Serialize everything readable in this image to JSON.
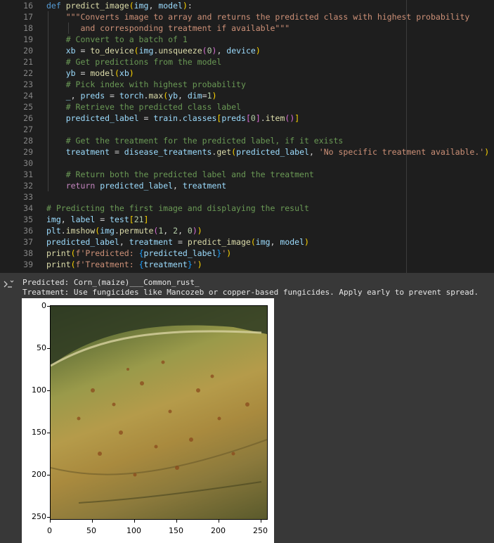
{
  "code": {
    "lines": [
      {
        "n": "16"
      },
      {
        "n": "17"
      },
      {
        "n": "18"
      },
      {
        "n": "19"
      },
      {
        "n": "20"
      },
      {
        "n": "21"
      },
      {
        "n": "22"
      },
      {
        "n": "23"
      },
      {
        "n": "24"
      },
      {
        "n": "25"
      },
      {
        "n": "26"
      },
      {
        "n": "27"
      },
      {
        "n": "28"
      },
      {
        "n": "29"
      },
      {
        "n": "30"
      },
      {
        "n": "31"
      },
      {
        "n": "32"
      },
      {
        "n": "33"
      },
      {
        "n": "34"
      },
      {
        "n": "35"
      },
      {
        "n": "36"
      },
      {
        "n": "37"
      },
      {
        "n": "38"
      },
      {
        "n": "39"
      }
    ]
  },
  "output": {
    "line1": "Predicted: Corn_(maize)___Common_rust_",
    "line2": "Treatment: Use fungicides like Mancozeb or copper-based fungicides. Apply early to prevent spread."
  },
  "plot": {
    "x_ticks": [
      "0",
      "50",
      "100",
      "150",
      "200",
      "250"
    ],
    "y_ticks": [
      "0",
      "50",
      "100",
      "150",
      "200",
      "250"
    ],
    "image_alt": "corn leaf with common rust"
  },
  "colors": {
    "editor_bg": "#1e1e1e",
    "output_bg": "#383838"
  }
}
